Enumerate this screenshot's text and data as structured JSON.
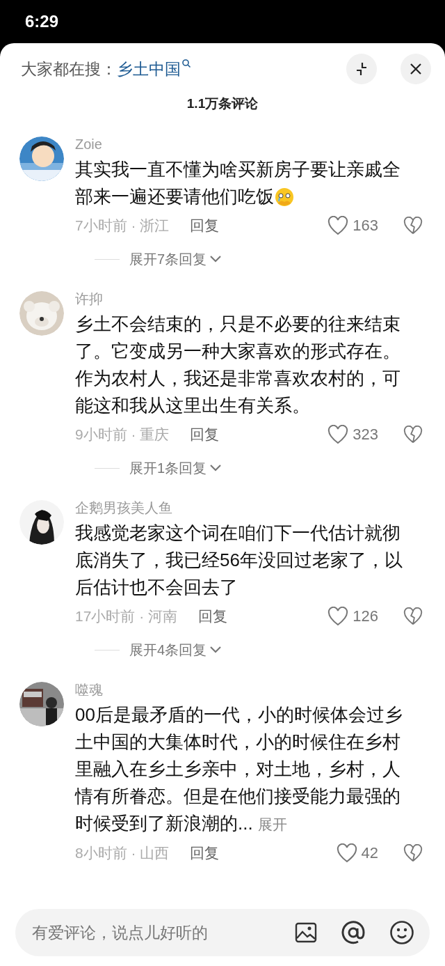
{
  "status_bar": {
    "time": "6:29"
  },
  "header": {
    "trending_label": "大家都在搜：",
    "trending_query": "乡土中国"
  },
  "title": "1.1万条评论",
  "comments": [
    {
      "user": "Zoie",
      "text": "其实我一直不懂为啥买新房子要让亲戚全部来一遍还要请他们吃饭",
      "emoji": true,
      "time_location": "7小时前 · 浙江",
      "reply": "回复",
      "likes": "163",
      "expand_replies": "展开7条回复"
    },
    {
      "user": "许抑",
      "text": "乡土不会结束的，只是不必要的往来结束了。它变成另一种大家喜欢的形式存在。作为农村人，我还是非常喜欢农村的，可能这和我从这里出生有关系。",
      "time_location": "9小时前 · 重庆",
      "reply": "回复",
      "likes": "323",
      "expand_replies": "展开1条回复"
    },
    {
      "user": "企鹅男孩美人鱼",
      "text": "我感觉老家这个词在咱们下一代估计就彻底消失了，我已经56年没回过老家了，以后估计也不会回去了",
      "time_location": "17小时前 · 河南",
      "reply": "回复",
      "likes": "126",
      "expand_replies": "展开4条回复"
    },
    {
      "user": "噬魂",
      "text": "00后是最矛盾的一代，小的时候体会过乡土中国的大集体时代，小的时候住在乡村里融入在乡土乡亲中，对土地，乡村，人情有所眷恋。但是在他们接受能力最强的时候受到了新浪潮的...",
      "more": "展开",
      "time_location": "8小时前 · 山西",
      "reply": "回复",
      "likes": "42"
    }
  ],
  "composer": {
    "placeholder": "有爱评论，说点儿好听的"
  }
}
